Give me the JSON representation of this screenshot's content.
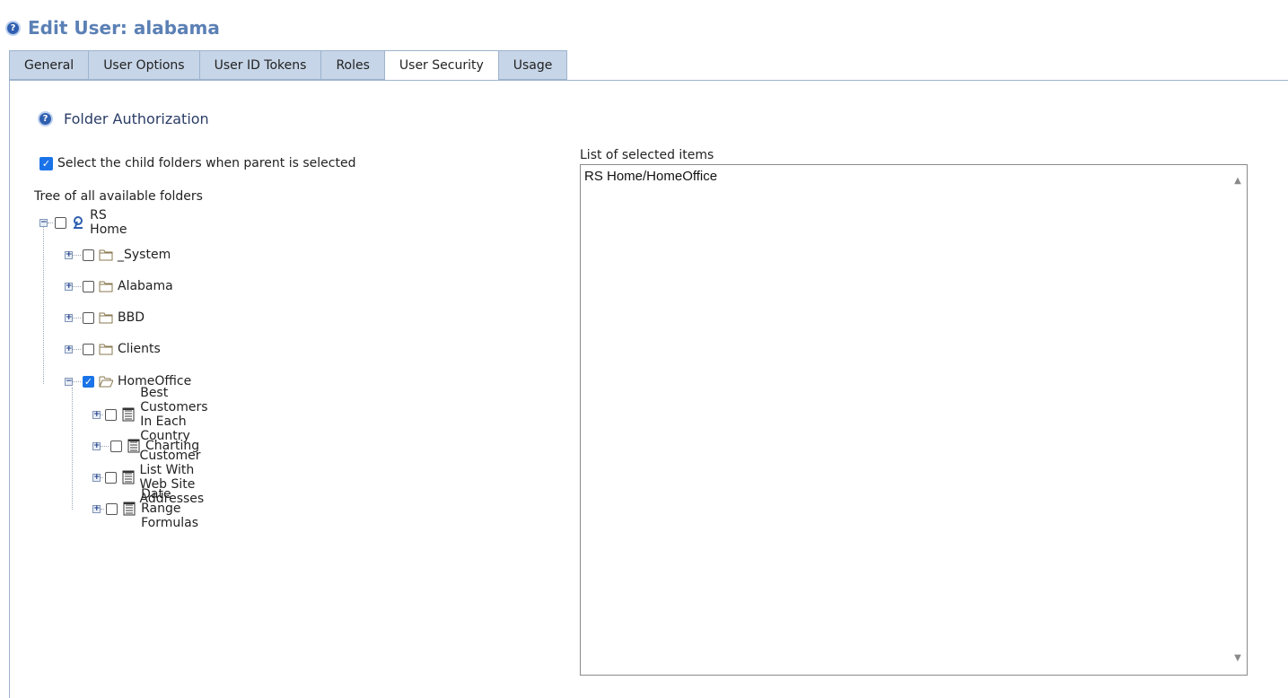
{
  "header": {
    "title": "Edit User: alabama",
    "help_icon": "help-circle-icon"
  },
  "tabs": [
    {
      "label": "General",
      "active": false
    },
    {
      "label": "User Options",
      "active": false
    },
    {
      "label": "User ID Tokens",
      "active": false
    },
    {
      "label": "Roles",
      "active": false
    },
    {
      "label": "User Security",
      "active": true
    },
    {
      "label": "Usage",
      "active": false
    }
  ],
  "section": {
    "title": "Folder Authorization"
  },
  "options": {
    "select_children_label": "Select the child folders when parent is selected",
    "select_children_checked": true
  },
  "tree": {
    "label": "Tree of all available folders",
    "nodes": [
      {
        "label": "RS Home",
        "icon": "home-icon",
        "expanded": true,
        "checked": false
      },
      {
        "label": "_System",
        "icon": "folder-icon",
        "expanded": false,
        "checked": false
      },
      {
        "label": "Alabama",
        "icon": "folder-icon",
        "expanded": false,
        "checked": false
      },
      {
        "label": "BBD",
        "icon": "folder-icon",
        "expanded": false,
        "checked": false
      },
      {
        "label": "Clients",
        "icon": "folder-icon",
        "expanded": false,
        "checked": false
      },
      {
        "label": "HomeOffice",
        "icon": "folder-open-icon",
        "expanded": true,
        "checked": true
      },
      {
        "label": "Best Customers In Each Country",
        "icon": "report-icon",
        "expanded": false,
        "checked": false
      },
      {
        "label": "Charting",
        "icon": "report-icon",
        "expanded": false,
        "checked": false
      },
      {
        "label": "Customer List With Web Site Addresses",
        "icon": "report-icon",
        "expanded": false,
        "checked": false
      },
      {
        "label": "Date Range Formulas",
        "icon": "report-icon",
        "expanded": false,
        "checked": false
      }
    ]
  },
  "selected_list": {
    "label": "List of selected items",
    "items": [
      "RS Home/HomeOffice"
    ]
  },
  "colors": {
    "title": "#5b80b5",
    "tab_bg": "#c6d5e7",
    "checkbox_checked": "#1a73e8"
  }
}
